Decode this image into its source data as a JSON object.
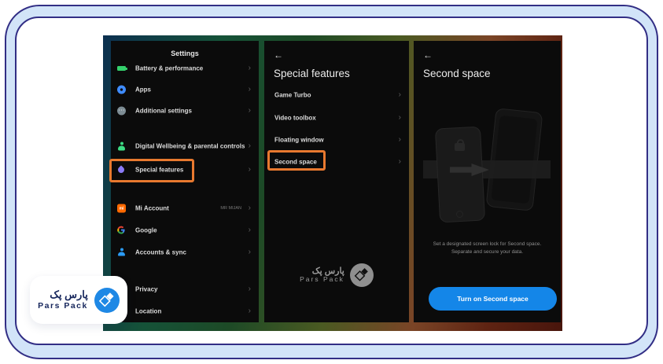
{
  "glyphs": {
    "chevron": "›",
    "back_arrow": "←",
    "mi_logo": "mi"
  },
  "branding": {
    "logo_fa": "پارس پک",
    "logo_en": "Pars Pack"
  },
  "settings_panel": {
    "title": "Settings",
    "items": [
      {
        "label": "Battery & performance"
      },
      {
        "label": "Apps"
      },
      {
        "label": "Additional settings"
      },
      {
        "label": "Digital Wellbeing & parental controls"
      },
      {
        "label": "Special features"
      },
      {
        "label": "Mi Account",
        "value": "MR MIJAN"
      },
      {
        "label": "Google"
      },
      {
        "label": "Accounts & sync"
      },
      {
        "label": "Privacy"
      },
      {
        "label": "Location"
      }
    ]
  },
  "special_features_panel": {
    "title": "Special features",
    "items": [
      {
        "label": "Game Turbo"
      },
      {
        "label": "Video toolbox"
      },
      {
        "label": "Floating window"
      },
      {
        "label": "Second space"
      }
    ]
  },
  "second_space_panel": {
    "title": "Second space",
    "description": [
      "Set a designated screen lock for Second space.",
      "Separate and secure your data."
    ],
    "button_label": "Turn on Second space"
  },
  "colors": {
    "highlight_orange": "#e8792f",
    "button_blue": "#1486e8",
    "brand_blue": "#1e88e5",
    "frame_navy": "#322e85",
    "frame_light_blue": "#d2e4f8"
  }
}
